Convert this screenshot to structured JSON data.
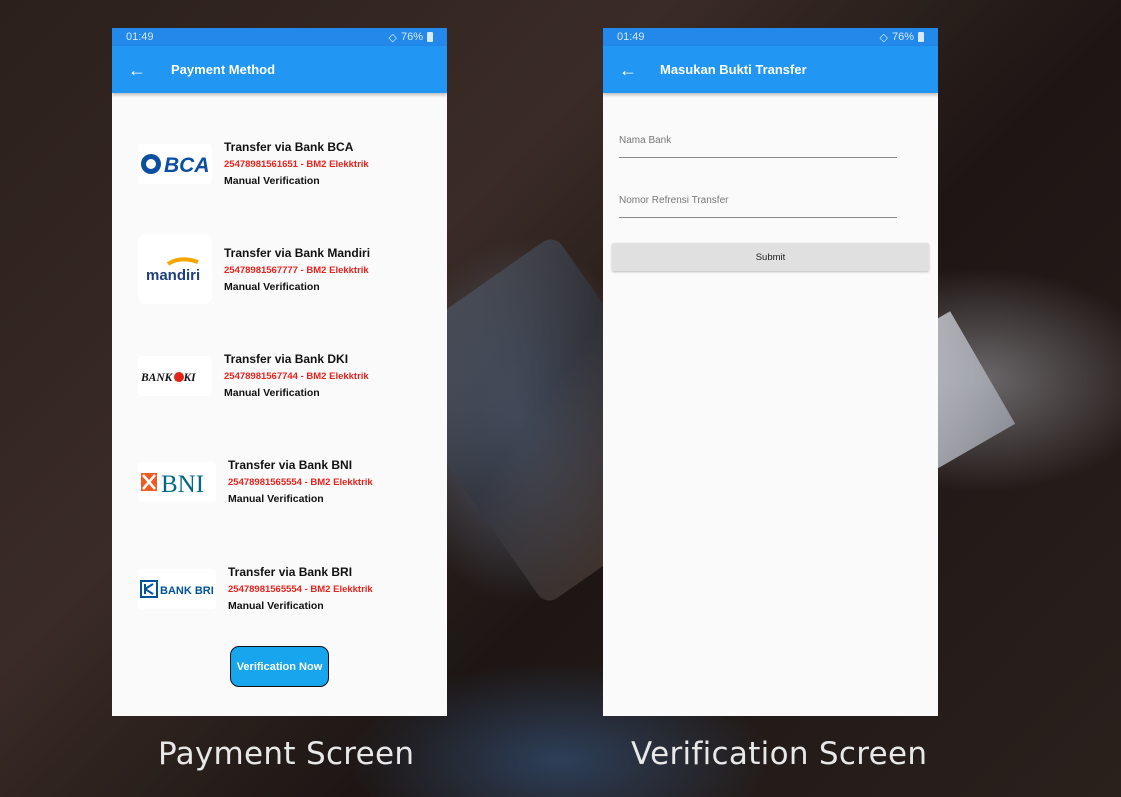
{
  "status_bar": {
    "time": "01:49",
    "battery": "76%"
  },
  "payment_screen": {
    "title": "Payment Method",
    "banks": [
      {
        "logo_text": "BCA",
        "title": "Transfer via Bank BCA",
        "account": "25478981561651 - BM2 Elekktrik",
        "verification": "Manual Verification"
      },
      {
        "logo_text": "mandiri",
        "title": "Transfer via Bank Mandiri",
        "account": "25478981567777 - BM2 Elekktrik",
        "verification": "Manual Verification"
      },
      {
        "logo_text": "BANK DKI",
        "title": "Transfer via Bank DKI",
        "account": "25478981567744 - BM2 Elekktrik",
        "verification": "Manual Verification"
      },
      {
        "logo_text": "BNI",
        "title": "Transfer via Bank BNI",
        "account": "25478981565554 - BM2 Elekktrik",
        "verification": "Manual Verification"
      },
      {
        "logo_text": "BANK BRI",
        "title": "Transfer via Bank BRI",
        "account": "25478981565554 - BM2 Elekktrik",
        "verification": "Manual Verification"
      }
    ],
    "verify_button": "Verification Now"
  },
  "verification_screen": {
    "title": "Masukan Bukti Transfer",
    "fields": [
      {
        "placeholder": "Nama Bank",
        "value": ""
      },
      {
        "placeholder": "Nomor Refrensi Transfer",
        "value": ""
      }
    ],
    "submit_label": "Submit"
  },
  "captions": {
    "left": "Payment Screen",
    "right": "Verification Screen"
  },
  "colors": {
    "app_bar": "#2196f3",
    "account_text": "#e8231d",
    "button": "#17a6ee"
  }
}
